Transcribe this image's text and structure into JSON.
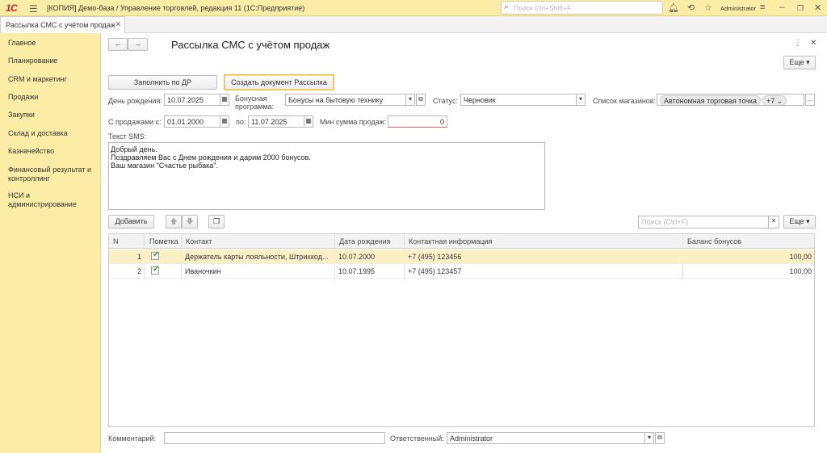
{
  "app": {
    "title": "[КОПИЯ] Демо-база / Управление торговлей, редакция 11  (1С:Предприятие)",
    "logo": "1С",
    "user": "Administrator"
  },
  "search": {
    "placeholder": "Поиск Ctrl+Shift+F"
  },
  "tab": {
    "label": "Рассылка СМС с учётом продаж"
  },
  "sidebar": {
    "items": [
      {
        "label": "Главное"
      },
      {
        "label": "Планирование"
      },
      {
        "label": "CRM и маркетинг"
      },
      {
        "label": "Продажи"
      },
      {
        "label": "Закупки"
      },
      {
        "label": "Склад и доставка"
      },
      {
        "label": "Казначейство"
      },
      {
        "label": "Финансовый результат и контроллинг"
      },
      {
        "label": "НСИ и администрирование"
      }
    ]
  },
  "form": {
    "title": "Рассылка СМС с учётом продаж",
    "more_label": "Еще",
    "fill_by_birthday": "Заполнить по ДР",
    "create_document": "Создать документ Рассылка",
    "birthday_label": "День рождения:",
    "birthday_value": "10.07.2025",
    "bonus_label": "Бонусная программа:",
    "bonus_value": "Бонусы на бытовую технику",
    "status_label": "Статус:",
    "status_value": "Черновик",
    "stores_label": "Список магазинов:",
    "store_chip": "Автономная торговая точка",
    "store_more": "+7",
    "sales_from_label": "С продажами с:",
    "sales_from_value": "01.01.2000",
    "sales_to_label": "по:",
    "sales_to_value": "11.07.2025",
    "min_sum_label": "Мин сумма продаж:",
    "min_sum_value": "0",
    "sms_label": "Текст SMS:",
    "sms_lines": [
      "Добрый день.",
      "Поздравляем Вас с Днем рождения и дарим 2000 бонусов.",
      "Ваш магазин \"Счастье рыбака\"."
    ]
  },
  "table": {
    "add_label": "Добавить",
    "search_placeholder": "Поиск (Ctrl+F)",
    "more_label": "Еще",
    "columns": [
      "N",
      "Пометка",
      "Контакт",
      "Дата рождения",
      "Контактная информация",
      "Баланс бонусов"
    ],
    "rows": [
      {
        "n": "1",
        "contact": "Держатель карты лояльности, Штрихкод...",
        "birthday": "10.07.2000",
        "info": "+7 (495) 123456",
        "balance": "100,00",
        "checked": true
      },
      {
        "n": "2",
        "contact": "Иваночкин",
        "birthday": "10.07.1995",
        "info": "+7 (495) 123457",
        "balance": "100,00",
        "checked": true
      }
    ]
  },
  "footer": {
    "comment_label": "Комментарий:",
    "comment_value": "",
    "responsible_label": "Ответственный:",
    "responsible_value": "Administrator"
  },
  "colors": {
    "panel": "#fbeda6",
    "accent": "#e6b83b",
    "selected_row": "#fbf0c5",
    "check": "#2a9a2a"
  }
}
